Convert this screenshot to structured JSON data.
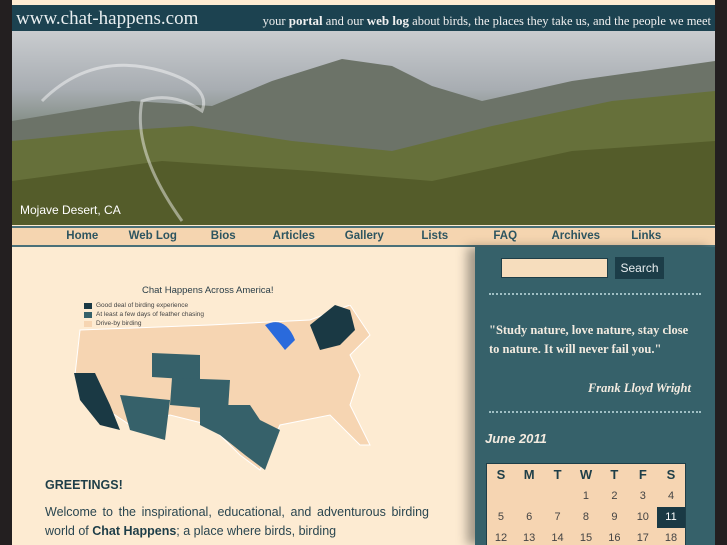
{
  "header": {
    "site_title": "www.chat-happens.com",
    "tagline": {
      "t1": "your ",
      "portal": "portal",
      "t2": " and our ",
      "weblog": "web log",
      "t3": " about birds, the places they take us, and the people we meet"
    }
  },
  "banner": {
    "caption": "Mojave Desert, CA"
  },
  "nav": [
    "Home",
    "Web Log",
    "Bios",
    "Articles",
    "Gallery",
    "Lists",
    "FAQ",
    "Archives",
    "Links"
  ],
  "map": {
    "title": "Chat Happens Across America!",
    "legend": [
      {
        "label": "Good deal of birding experience",
        "color": "#1a3944"
      },
      {
        "label": "At least a few days of feather chasing",
        "color": "#36616a"
      },
      {
        "label": "Drive-by birding",
        "color": "#f6d5b2"
      }
    ]
  },
  "content": {
    "heading": "GREETINGS!",
    "welcome_1": "Welcome to the inspirational, educational, and adventurous birding world of ",
    "brand": "Chat Happens",
    "welcome_2": "; a place where birds, birding"
  },
  "sidebar": {
    "search_button": "Search",
    "search_value": "",
    "quote": "\"Study nature, love nature, stay close to nature. It will never fail you.\"",
    "author": "Frank Lloyd Wright",
    "calendar": {
      "month": "June 2011",
      "days": [
        "S",
        "M",
        "T",
        "W",
        "T",
        "F",
        "S"
      ],
      "weeks": [
        [
          "",
          "",
          "",
          "1",
          "2",
          "3",
          "4"
        ],
        [
          "5",
          "6",
          "7",
          "8",
          "9",
          "10",
          "11"
        ],
        [
          "12",
          "13",
          "14",
          "15",
          "16",
          "17",
          "18"
        ]
      ],
      "today": "11"
    }
  }
}
